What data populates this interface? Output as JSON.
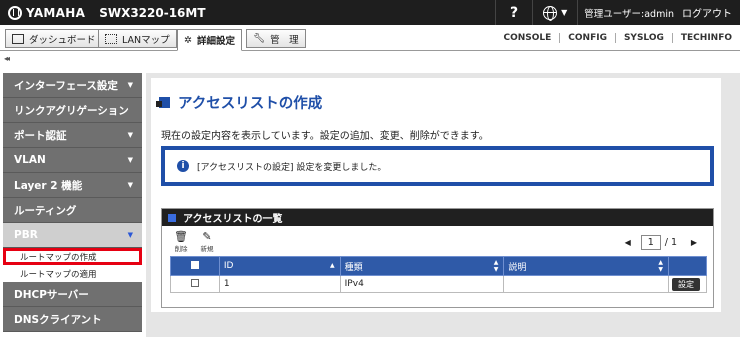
{
  "header": {
    "brand": "YAMAHA",
    "model": "SWX3220-16MT",
    "help_label": "?",
    "user_label": "管理ユーザー:admin",
    "logout_label": "ログアウト"
  },
  "tabs": [
    {
      "label": "ダッシュボード"
    },
    {
      "label": "LANマップ"
    },
    {
      "label": "詳細設定"
    },
    {
      "label": "管　理"
    }
  ],
  "top_links": [
    "CONSOLE",
    "CONFIG",
    "SYSLOG",
    "TECHINFO"
  ],
  "collapse_label": "◂◂",
  "sidebar": {
    "items": [
      {
        "label": "インターフェース設定",
        "arrow": "▼"
      },
      {
        "label": "リンクアグリゲーション",
        "arrow": ""
      },
      {
        "label": "ポート認証",
        "arrow": "▼"
      },
      {
        "label": "VLAN",
        "arrow": "▼"
      },
      {
        "label": "Layer 2 機能",
        "arrow": "▼"
      },
      {
        "label": "ルーティング",
        "arrow": ""
      },
      {
        "label": "PBR",
        "arrow": "▼"
      }
    ],
    "sub_items": [
      {
        "label": "ルートマップの作成"
      },
      {
        "label": "ルートマップの適用"
      }
    ],
    "bottom_items": [
      {
        "label": "DHCPサーバー",
        "arrow": ""
      },
      {
        "label": "DNSクライアント",
        "arrow": ""
      }
    ]
  },
  "main": {
    "title": "アクセスリストの作成",
    "description": "現在の設定内容を表示しています。設定の追加、変更、削除ができます。",
    "notice": "[アクセスリストの設定] 設定を変更しました。",
    "list": {
      "header": "アクセスリストの一覧",
      "delete_label": "削除",
      "new_label": "新規",
      "page_current": "1",
      "page_total": "/ 1",
      "columns": [
        "ID",
        "種類",
        "説明"
      ],
      "rows": [
        {
          "id": "1",
          "type": "IPv4",
          "desc": "",
          "action": "設定"
        }
      ]
    }
  },
  "colors": {
    "accent": "#1f4fa8",
    "topbar": "#1e1e1e",
    "sidebar": "#707070",
    "highlight": "#e60012"
  }
}
